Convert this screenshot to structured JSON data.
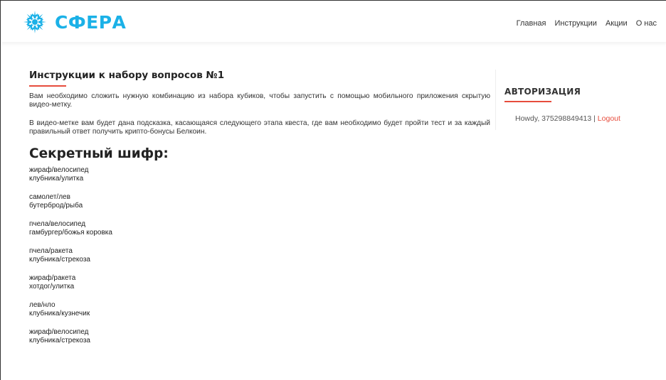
{
  "header": {
    "logo_text": "СФЕРА",
    "logo_icon": "snowflake-icon",
    "brand_color": "#1bb1e7",
    "nav": [
      "Главная",
      "Инструкции",
      "Акции",
      "О нас"
    ]
  },
  "main": {
    "title": "Инструкции к набору вопросов №1",
    "paragraphs": [
      "Вам необходимо сложить нужную комбинацию из набора кубиков, чтобы запустить с помощью мобильного приложения скрытую видео-метку.",
      "В видео-метке вам будет дана подсказка, касающаяся следующего этапа квеста, где вам необходимо будет пройти тест и за каждый правильный ответ получить крипто-бонусы Белкоин."
    ],
    "cipher_title": "Секретный шифр:",
    "pairs": [
      [
        "жираф/велосипед",
        "клубника/улитка"
      ],
      [
        "самолет/лев",
        "бутерброд/рыба"
      ],
      [
        "пчела/велосипед",
        "гамбургер/божья коровка"
      ],
      [
        "пчела/ракета",
        "клубника/стрекоза"
      ],
      [
        "жираф/ракета",
        "хотдог/улитка"
      ],
      [
        "лев/нло",
        "клубника/кузнечик"
      ],
      [
        "жираф/велосипед",
        "клубника/стрекоза"
      ]
    ]
  },
  "sidebar": {
    "title": "АВТОРИЗАЦИЯ",
    "howdy": "Howdy, 375298849413 | ",
    "logout": "Logout",
    "accent_color": "#e74c3c"
  }
}
